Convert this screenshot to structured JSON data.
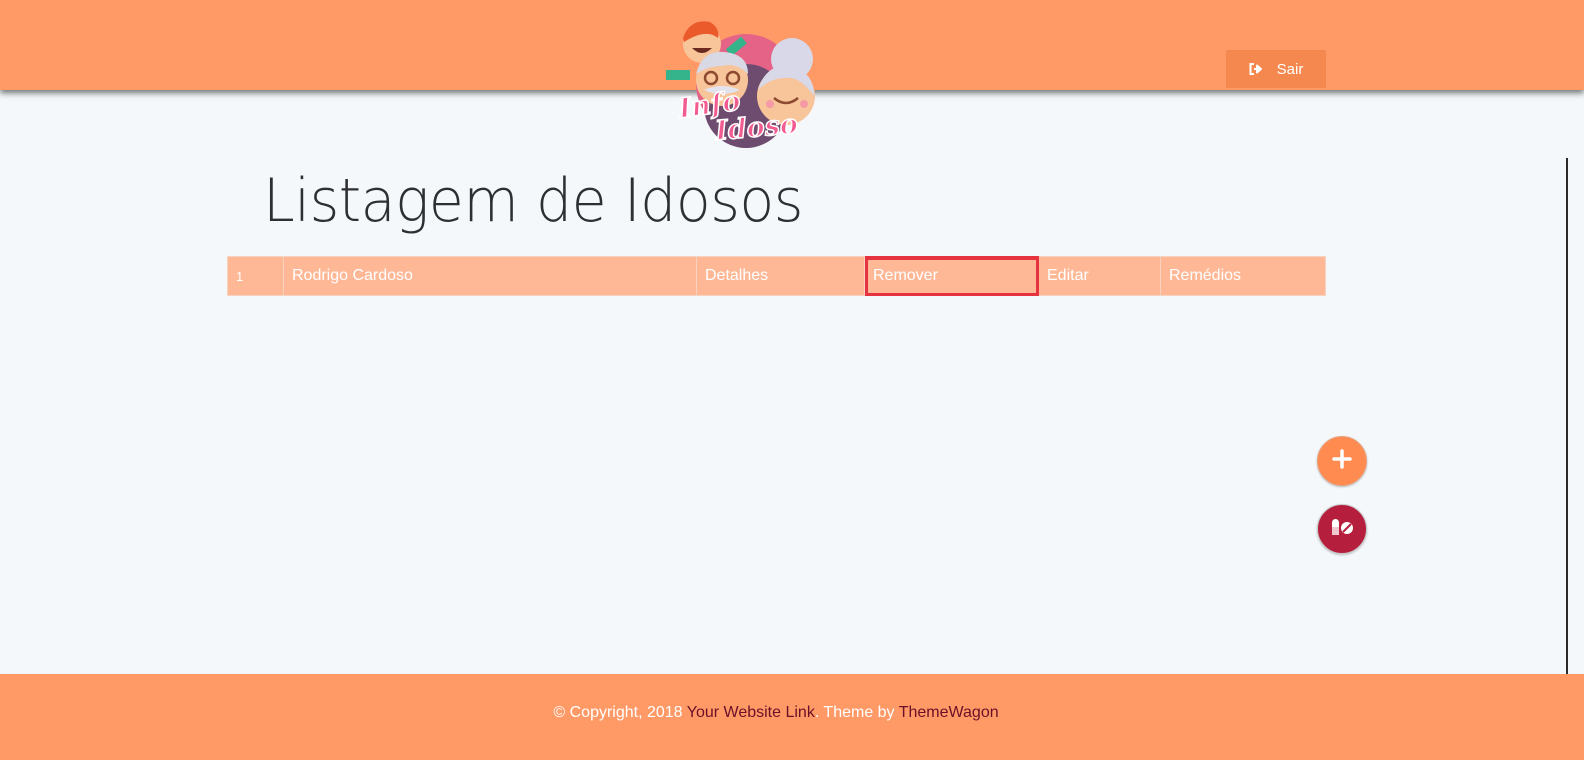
{
  "header": {
    "logo_text": "Info Idoso",
    "logout_label": "Sair"
  },
  "main": {
    "title": "Listagem de Idosos",
    "rows": [
      {
        "index": "1",
        "name": "Rodrigo Cardoso",
        "details": "Detalhes",
        "remove": "Remover",
        "edit": "Editar",
        "medicines": "Remédios"
      }
    ]
  },
  "actions": {
    "add_icon": "plus-icon",
    "medicine_icon": "pills-icon"
  },
  "footer": {
    "copyright": "© Copyright, 2018 ",
    "site_link": "Your Website Link",
    "theme_by": ". Theme by ",
    "theme_link": "ThemeWagon"
  },
  "colors": {
    "header_bg": "#ff9966",
    "row_bg": "#ffb896",
    "highlight": "#e5333f",
    "fab_add": "#ff8b50",
    "fab_med": "#b51e3d",
    "footer_link": "#6b1028"
  }
}
